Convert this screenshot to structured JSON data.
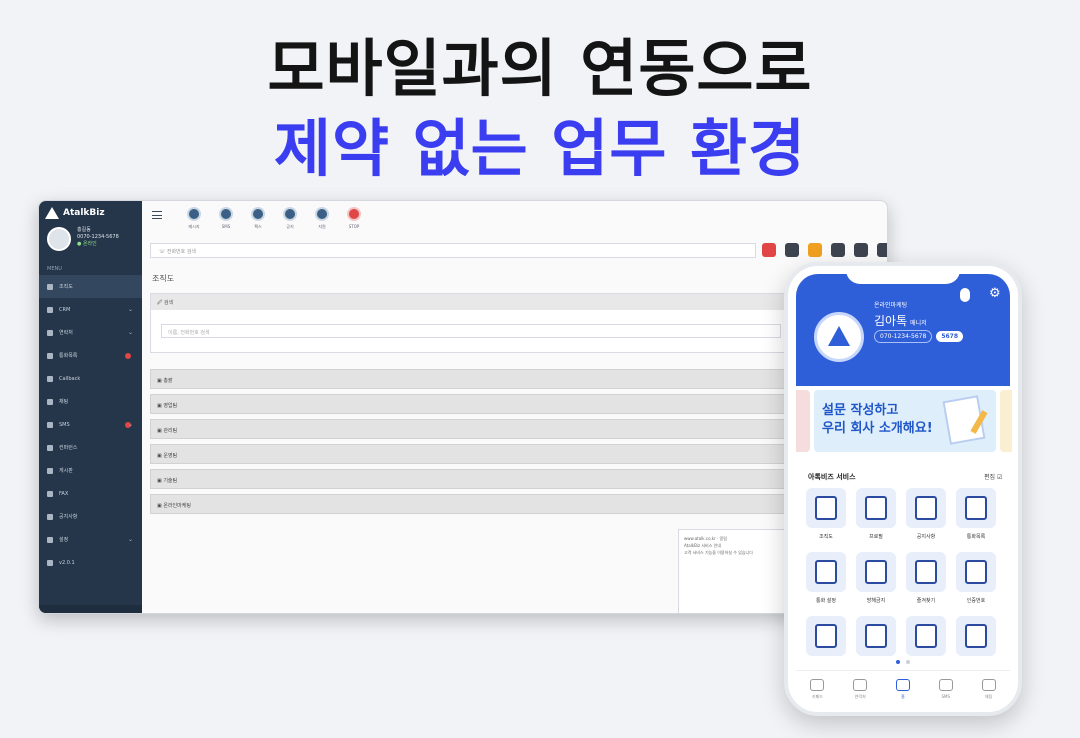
{
  "headline": {
    "line1": "모바일과의 연동으로",
    "line2": "제약 없는 업무 환경",
    "accent_color": "#3a3df0"
  },
  "desktop": {
    "logo_text": "AtalkBiz",
    "profile": {
      "name": "홍길동",
      "sub": "0070-1234-5678",
      "status": "온라인"
    },
    "menu_title": "MENU",
    "menu": [
      {
        "label": "조직도",
        "icon": "org-icon",
        "active": true
      },
      {
        "label": "CRM",
        "icon": "crm-icon",
        "chevron": true
      },
      {
        "label": "연락처",
        "icon": "contact-icon",
        "chevron": true
      },
      {
        "label": "통화목록",
        "icon": "call-list-icon",
        "badge": true
      },
      {
        "label": "Callback",
        "icon": "callback-icon"
      },
      {
        "label": "채팅",
        "icon": "chat-icon"
      },
      {
        "label": "SMS",
        "icon": "sms-icon",
        "badge": true,
        "chevron": true
      },
      {
        "label": "컨퍼런스",
        "icon": "conference-icon"
      },
      {
        "label": "게시판",
        "icon": "board-icon"
      },
      {
        "label": "FAX",
        "icon": "fax-icon"
      },
      {
        "label": "공지사항",
        "icon": "notice-icon"
      },
      {
        "label": "설정",
        "icon": "settings-icon",
        "chevron": true
      },
      {
        "label": "v2.0.1",
        "icon": "info-icon"
      }
    ],
    "toolbar": [
      {
        "label": "메시지"
      },
      {
        "label": "SMS"
      },
      {
        "label": "팩스"
      },
      {
        "label": "공지"
      },
      {
        "label": "지원"
      },
      {
        "label": "STOP",
        "stop": true
      }
    ],
    "search_placeholder": "전화번호 검색",
    "page_title": "조직도",
    "panel_header": "검색",
    "panel_input_placeholder": "이름, 전화번호 검색",
    "groups": [
      "총괄",
      "영업팀",
      "관리팀",
      "운영팀",
      "기술팀",
      "온라인마케팅"
    ],
    "popup": {
      "line1": "www.atalk.co.kr · 알림",
      "line2": "AtalkBiz 서비스 안내",
      "line3": "고객 서비스 기능을 이용하실 수 있습니다"
    }
  },
  "phone": {
    "team": "온라인마케팅",
    "name": "김아톡",
    "role": "매니저",
    "number": "070-1234-5678",
    "ext": "5678",
    "banner_line1": "설문 작성하고",
    "banner_line2": "우리 회사 소개해요!",
    "services_title": "아톡비즈 서비스",
    "edit_label": "편집",
    "services": [
      "조직도",
      "프로필",
      "공지사항",
      "통화목록",
      "통화 설정",
      "방해금지",
      "즐겨찾기",
      "인증번호",
      "",
      "",
      "",
      ""
    ],
    "nav": [
      {
        "label": "키패드"
      },
      {
        "label": "연락처"
      },
      {
        "label": "홈",
        "active": true
      },
      {
        "label": "SMS"
      },
      {
        "label": "채팅"
      }
    ]
  }
}
